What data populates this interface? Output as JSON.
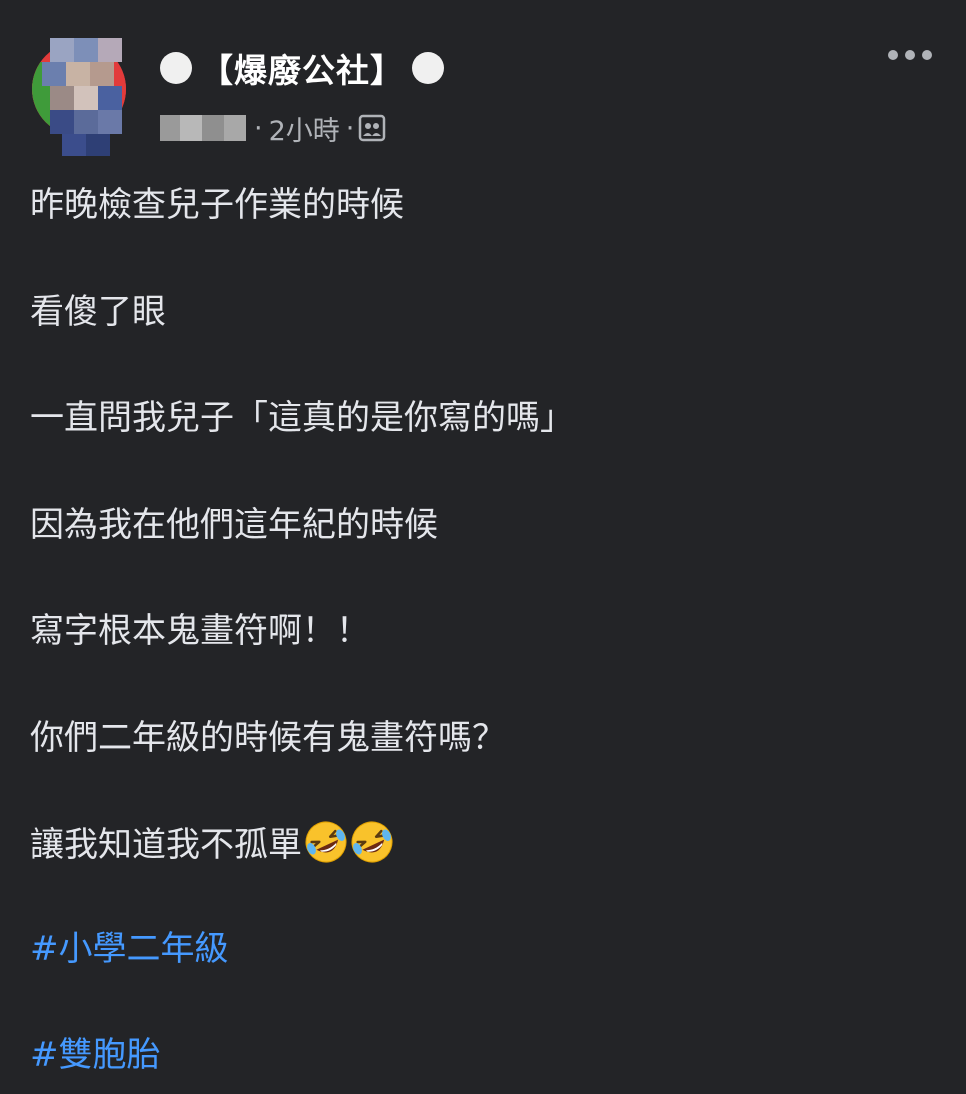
{
  "header": {
    "page_name": "【爆廢公社】",
    "time": "2小時",
    "separator": "·"
  },
  "icons": {
    "more": "more-horizontal-icon",
    "audience": "group-audience-icon",
    "emoji": "rolling-on-floor-laughing-emoji"
  },
  "post": {
    "lines": [
      "昨晚檢查兒子作業的時候",
      "看傻了眼",
      "一直問我兒子「這真的是你寫的嗎」",
      "因為我在他們這年紀的時候",
      "寫字根本鬼畫符啊！！",
      "你們二年級的時候有鬼畫符嗎？",
      "讓我知道我不孤單"
    ],
    "hashtags": [
      "#小學二年級",
      "#雙胞胎"
    ]
  },
  "colors": {
    "background": "#232427",
    "text": "#e4e6eb",
    "muted": "#b0b3b8",
    "link": "#4599ff"
  }
}
